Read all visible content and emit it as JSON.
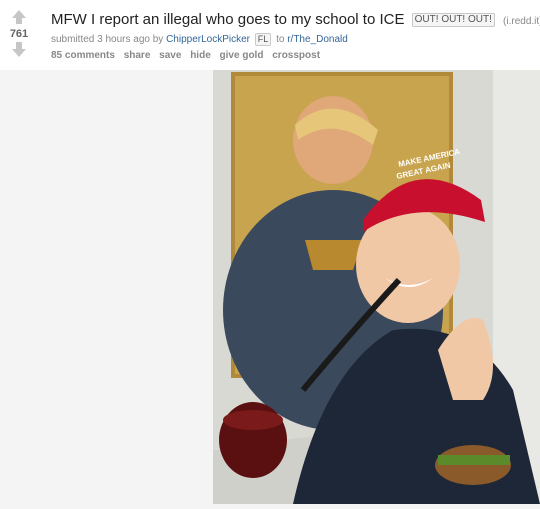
{
  "post": {
    "score": "761",
    "title": "MFW I report an illegal who goes to my school to ICE",
    "title_flair": "OUT! OUT! OUT!",
    "domain": "(i.redd.it)",
    "tagline": {
      "submitted": "submitted 3 hours ago by",
      "author": "ChipperLockPicker",
      "author_flair": "FL",
      "to": "to",
      "subreddit": "r/The_Donald"
    },
    "buttons": {
      "comments": "85 comments",
      "share": "share",
      "save": "save",
      "hide": "hide",
      "give_gold": "give gold",
      "crosspost": "crosspost"
    },
    "image": {
      "hat_text_line1": "MAKE AMERICA",
      "hat_text_line2": "GREAT AGAIN"
    }
  },
  "colors": {
    "link": "#336699",
    "title": "#222222",
    "meta": "#888888",
    "hat_red": "#c8102e"
  }
}
